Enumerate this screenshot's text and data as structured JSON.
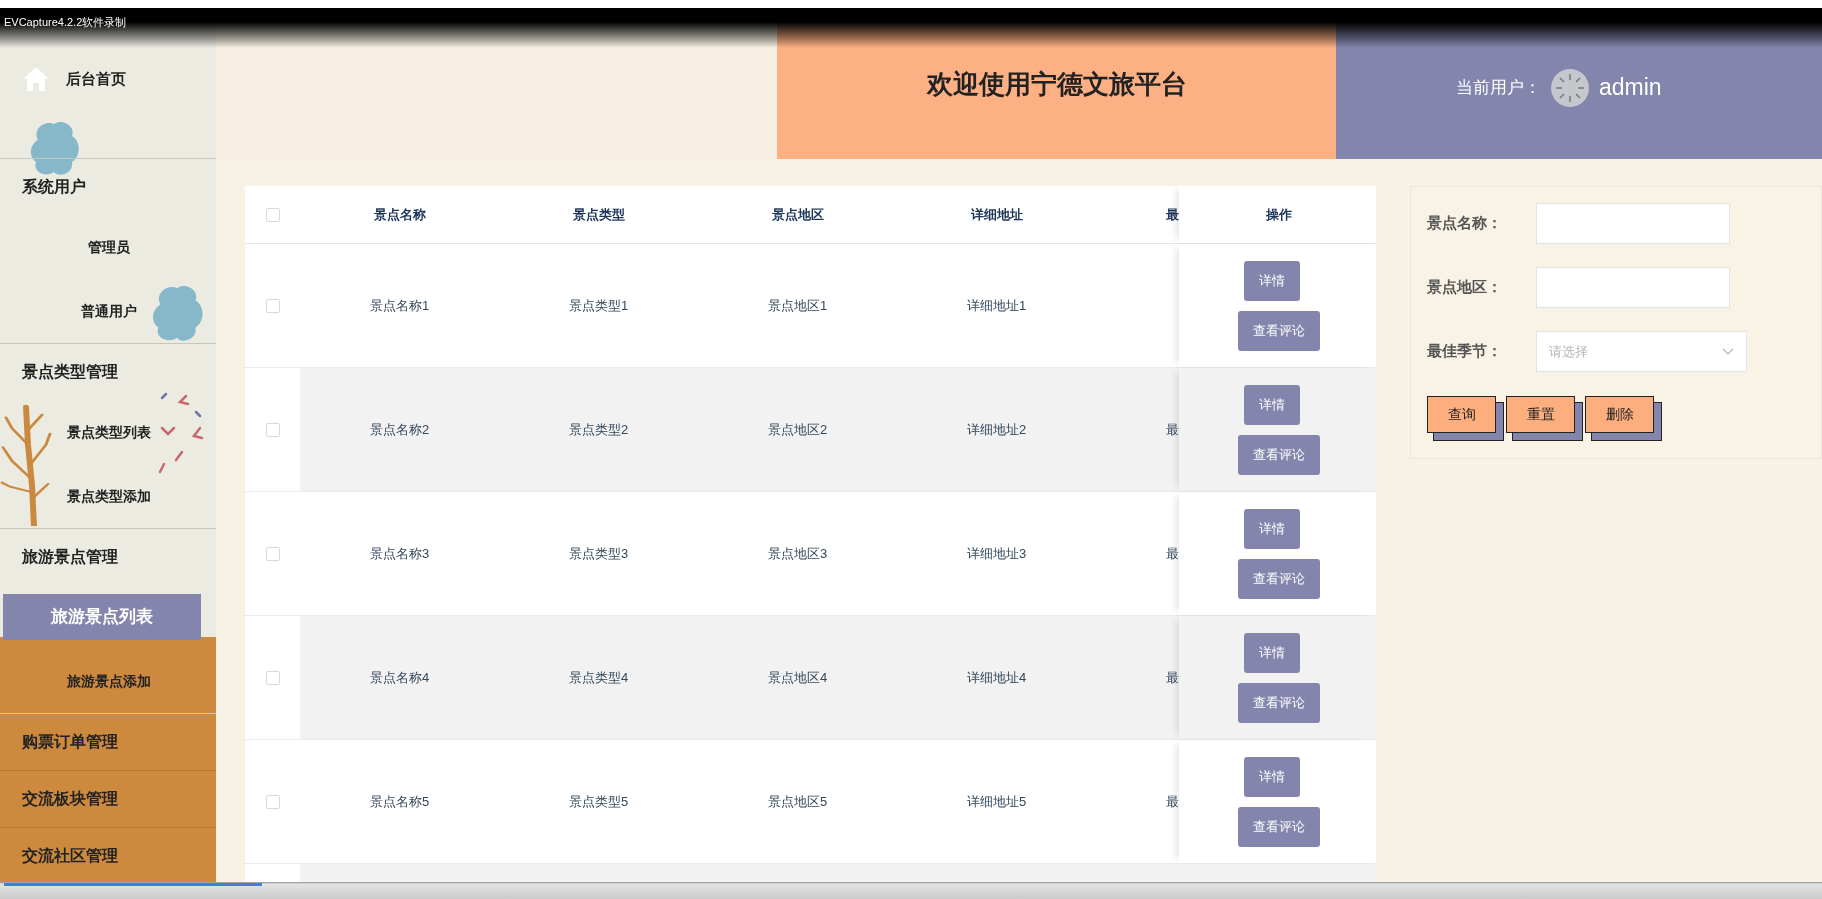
{
  "capture_bar": {
    "title": "EVCapture4.2.2软件录制"
  },
  "sidebar": {
    "items": [
      {
        "kind": "link",
        "label": "后台首页",
        "selected": false
      },
      {
        "kind": "group",
        "label": "系统用户",
        "selected": false,
        "children": [
          {
            "label": "管理员",
            "selected": false
          },
          {
            "label": "普通用户",
            "selected": false
          }
        ]
      },
      {
        "kind": "group",
        "label": "景点类型管理",
        "selected": false,
        "children": [
          {
            "label": "景点类型列表",
            "selected": false
          },
          {
            "label": "景点类型添加",
            "selected": false
          }
        ]
      },
      {
        "kind": "group",
        "label": "旅游景点管理",
        "selected": false,
        "children": [
          {
            "label": "旅游景点列表",
            "selected": true
          },
          {
            "label": "旅游景点添加",
            "selected": false
          }
        ]
      },
      {
        "kind": "group",
        "label": "购票订单管理",
        "selected": false
      },
      {
        "kind": "group",
        "label": "交流板块管理",
        "selected": false
      },
      {
        "kind": "group",
        "label": "交流社区管理",
        "selected": false
      }
    ]
  },
  "header": {
    "title": "欢迎使用宁德文旅平台",
    "user_label": "当前用户：",
    "username": "admin"
  },
  "table": {
    "header_checked": false,
    "columns": [
      "景点名称",
      "景点类型",
      "景点地区",
      "详细地址",
      "最"
    ],
    "action_column": "操作",
    "rows": [
      {
        "checked": false,
        "cells": [
          "景点名称1",
          "景点类型1",
          "景点地区1",
          "详细地址1"
        ],
        "actions": [
          "详情",
          "查看评论"
        ]
      },
      {
        "checked": false,
        "cells": [
          "景点名称2",
          "景点类型2",
          "景点地区2",
          "详细地址2",
          "最"
        ],
        "actions": [
          "详情",
          "查看评论"
        ]
      },
      {
        "checked": false,
        "cells": [
          "景点名称3",
          "景点类型3",
          "景点地区3",
          "详细地址3",
          "最"
        ],
        "actions": [
          "详情",
          "查看评论"
        ]
      },
      {
        "checked": false,
        "cells": [
          "景点名称4",
          "景点类型4",
          "景点地区4",
          "详细地址4",
          "最"
        ],
        "actions": [
          "详情",
          "查看评论"
        ]
      },
      {
        "checked": false,
        "cells": [
          "景点名称5",
          "景点类型5",
          "景点地区5",
          "详细地址5",
          "最"
        ],
        "actions": [
          "详情",
          "查看评论"
        ]
      }
    ]
  },
  "search": {
    "fields": [
      {
        "kind": "text",
        "label": "景点名称："
      },
      {
        "kind": "text",
        "label": "景点地区："
      },
      {
        "kind": "select",
        "label": "最佳季节：",
        "placeholder": "请选择"
      }
    ],
    "buttons": [
      "查询",
      "重置",
      "删除"
    ]
  }
}
